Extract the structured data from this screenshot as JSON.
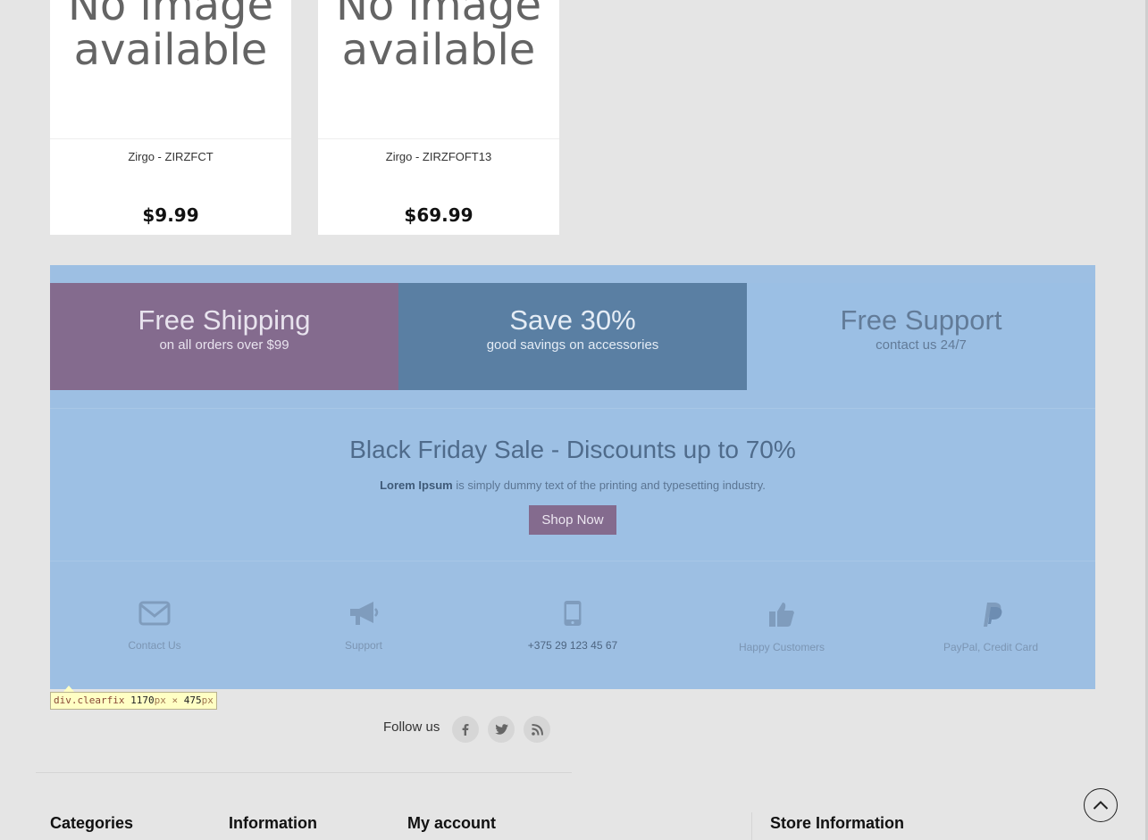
{
  "products": [
    {
      "image_text_line1": "No image",
      "image_text_line2": "available",
      "name": "Zirgo - ZIRZFCT",
      "price": "$9.99"
    },
    {
      "image_text_line1": "No image",
      "image_text_line2": "available",
      "name": "Zirgo - ZIRZFOFT13",
      "price": "$69.99"
    }
  ],
  "banners": [
    {
      "title": "Free Shipping",
      "subtitle": "on all orders over $99"
    },
    {
      "title": "Save 30%",
      "subtitle": "good savings on accessories"
    },
    {
      "title": "Free Support",
      "subtitle": "contact us 24/7"
    }
  ],
  "sale": {
    "title": "Black Friday Sale - Discounts up to 70%",
    "text_bold": "Lorem Ipsum",
    "text_rest": " is simply dummy text of the printing and typesetting industry.",
    "button": "Shop Now"
  },
  "features": [
    {
      "icon": "envelope-icon",
      "label": "Contact Us"
    },
    {
      "icon": "megaphone-icon",
      "label": "Support"
    },
    {
      "icon": "mobile-phone-icon",
      "label": "+375 29 123 45 67"
    },
    {
      "icon": "thumbs-up-icon",
      "label": "Happy Customers"
    },
    {
      "icon": "paypal-icon",
      "label": "PayPal, Credit Card"
    }
  ],
  "inspector_tooltip": {
    "selector": "div.clearfix",
    "width": "1170",
    "height": "475",
    "unit": "px",
    "times": "×"
  },
  "follow": {
    "label": "Follow us",
    "icons": [
      "facebook-icon",
      "twitter-icon",
      "rss-icon"
    ]
  },
  "footer": {
    "headings": [
      "Categories",
      "Information",
      "My account",
      "Store Information"
    ]
  },
  "colors": {
    "page_bg": "#e5e5e5",
    "highlight_overlay": "#9dbfe3",
    "purple_accent": "#846b8e",
    "steel_blue": "#5a7fa3"
  }
}
